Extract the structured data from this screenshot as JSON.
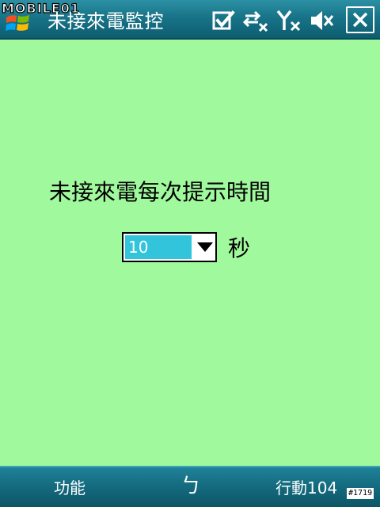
{
  "titlebar": {
    "app_title": "未接來電監控",
    "watermark": "MOBILE01",
    "icons": [
      "start-logo-icon",
      "watermark-logo",
      "ok-check-icon",
      "connectivity-icon",
      "signal-off-icon",
      "speaker-muted-icon",
      "close-icon"
    ]
  },
  "form": {
    "prompt_label": "未接來電每次提示時間",
    "interval_select": {
      "selected_value": "10",
      "unit_label": "秒"
    }
  },
  "softkeys": {
    "left_label": "功能",
    "center_label": "ㄅ",
    "right_label": "行動104"
  },
  "reference_tag": "#1719",
  "colors": {
    "background": "#a0f99d",
    "titlebar": "#187488",
    "selection_highlight": "#31c4db"
  }
}
